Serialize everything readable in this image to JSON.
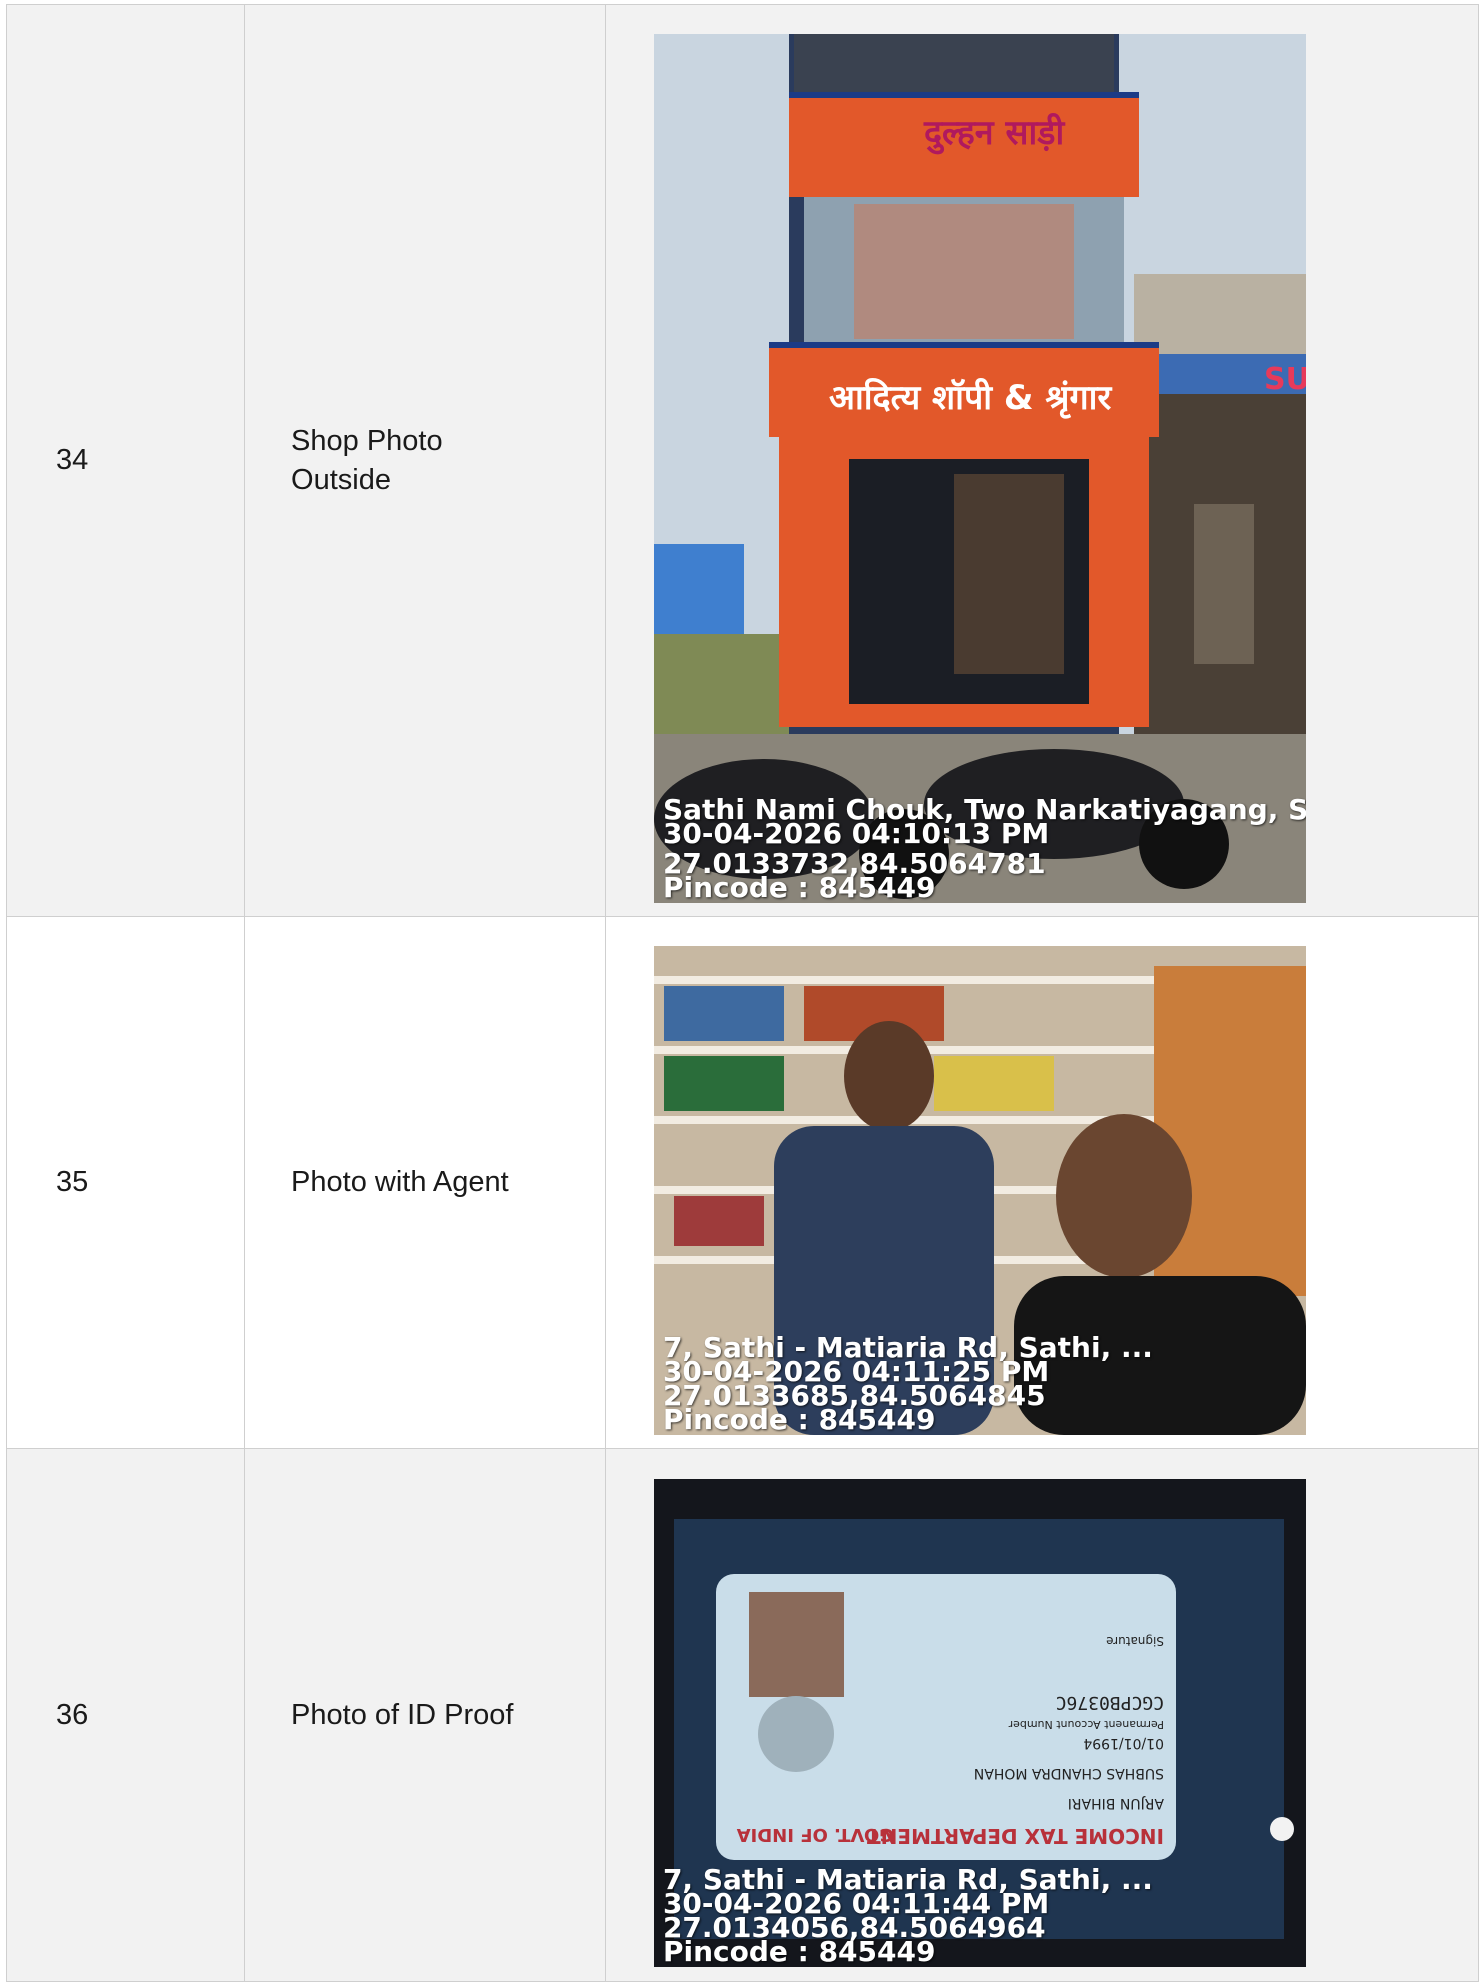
{
  "rows": [
    {
      "number": "34",
      "label": "Shop Photo Outside",
      "photo": {
        "subject": "shop-front",
        "stamp": {
          "address": "Sathi Nami Chouk, Two Narkatiyagang, Sathi",
          "datetime": "30-04-2026 04:10:13 PM",
          "coords": "27.0133732,84.5064781",
          "pincode": "Pincode : 845449"
        },
        "signboards": {
          "top": "दुल्हन साड़ी",
          "middle": "आदित्य शॉपी & श्रृंगार",
          "side": "SUP"
        }
      }
    },
    {
      "number": "35",
      "label": "Photo with Agent",
      "photo": {
        "subject": "selfie-with-agent",
        "stamp": {
          "address": "7, Sathi - Matiaria Rd, Sathi, ...",
          "datetime": "30-04-2026 04:11:25 PM",
          "coords": "27.0133685,84.5064845",
          "pincode": "Pincode : 845449"
        }
      }
    },
    {
      "number": "36",
      "label": "Photo of ID Proof",
      "photo": {
        "subject": "pan-card",
        "stamp": {
          "address": "7, Sathi - Matiaria Rd, Sathi, ...",
          "datetime": "30-04-2026 04:11:44 PM",
          "coords": "27.0134056,84.5064964",
          "pincode": "Pincode : 845449"
        },
        "card": {
          "name": "SUBHAS CHANDRA MOHAN",
          "father": "ARJUN BIHARI",
          "dob": "01/01/1994",
          "pan_label": "Permanent Account Number",
          "pan": "CGCPB0376C",
          "dept": "INCOME TAX DEPARTMENT",
          "govt": "GOVT. OF INDIA",
          "sign_label": "Signature"
        }
      }
    }
  ],
  "colors": {
    "shop_orange": "#e2582a",
    "shop_blue": "#1c3b86",
    "card_blue": "#c9dde9",
    "sky": "#c9d5e0"
  }
}
